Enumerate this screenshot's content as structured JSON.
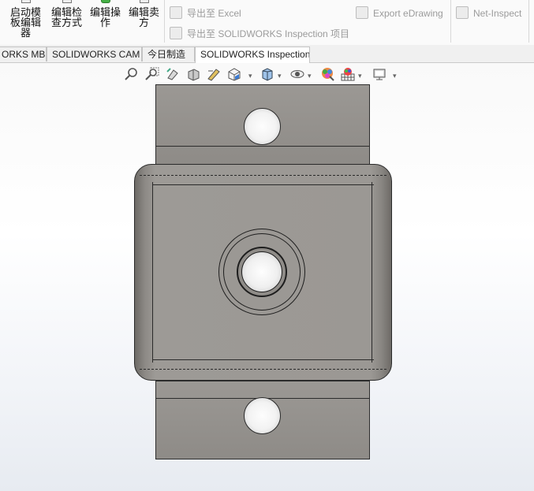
{
  "ribbon": {
    "buttons": [
      {
        "label": "启动模\n板编辑\n器"
      },
      {
        "label": "编辑检\n查方式"
      },
      {
        "label": "编辑操\n作"
      },
      {
        "label": "编辑卖\n方"
      }
    ],
    "export_excel": "导出至 Excel",
    "export_edrawing": "Export eDrawing",
    "net_inspect": "Net-Inspect",
    "export_project": "导出至 SOLIDWORKS Inspection 项目"
  },
  "tabs": [
    {
      "label": "ORKS MBD"
    },
    {
      "label": "SOLIDWORKS CAM"
    },
    {
      "label": "今日制造"
    },
    {
      "label": "SOLIDWORKS Inspection"
    }
  ],
  "active_tab": "SOLIDWORKS Inspection",
  "colors": {
    "part_face": "#9b9894",
    "part_edge": "#2c2c2c",
    "ribbon_bg": "#fafafa",
    "disabled_text": "#9b9b9b"
  },
  "hud_icons": [
    "zoom-to-fit-icon",
    "zoom-to-area-icon",
    "previous-view-icon",
    "section-view-icon",
    "dynamic-annotation-icon",
    "view-orientation-icon",
    "display-style-icon",
    "hide-show-icon",
    "edit-appearance-icon",
    "apply-scene-icon",
    "view-settings-icon"
  ]
}
